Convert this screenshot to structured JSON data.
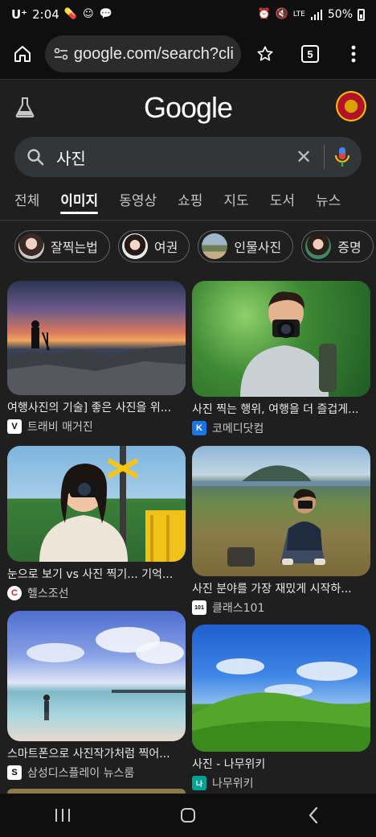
{
  "status_bar": {
    "carrier": "U⁺",
    "time": "2:04",
    "network": "LTE",
    "battery": "50%"
  },
  "browser": {
    "url": "google.com/search?cli",
    "tab_count": "5"
  },
  "google": {
    "logo": "Google"
  },
  "search": {
    "query": "사진"
  },
  "tabs": [
    {
      "label": "전체",
      "active": false
    },
    {
      "label": "이미지",
      "active": true
    },
    {
      "label": "동영상",
      "active": false
    },
    {
      "label": "쇼핑",
      "active": false
    },
    {
      "label": "지도",
      "active": false
    },
    {
      "label": "도서",
      "active": false
    },
    {
      "label": "뉴스",
      "active": false
    }
  ],
  "chips": [
    {
      "label": "잘찍는법"
    },
    {
      "label": "여권"
    },
    {
      "label": "인물사진"
    },
    {
      "label": "증명"
    }
  ],
  "results": [
    {
      "title": "여행사진의 기술] 좋은 사진을 위...",
      "source": "트래비 매거진",
      "favicon": "V"
    },
    {
      "title": "사진 찍는 행위, 여행을 더 즐겁게...",
      "source": "코메디닷컴",
      "favicon": "K"
    },
    {
      "title": "눈으로 보기 vs 사진 찍기... 기억...",
      "source": "헬스조선",
      "favicon": "C"
    },
    {
      "title": "사진 분야를 가장 재밌게 시작하...",
      "source": "클래스101",
      "favicon": "101"
    },
    {
      "title": "스마트폰으로 사진작가처럼 찍어...",
      "source": "삼성디스플레이 뉴스룸",
      "favicon": "S"
    },
    {
      "title": "사진 - 나무위키",
      "source": "나무위키",
      "favicon": "나"
    }
  ],
  "colors": {
    "background": "#1f1f1f",
    "search_bg": "#333638",
    "chip_border": "#5f6368"
  }
}
